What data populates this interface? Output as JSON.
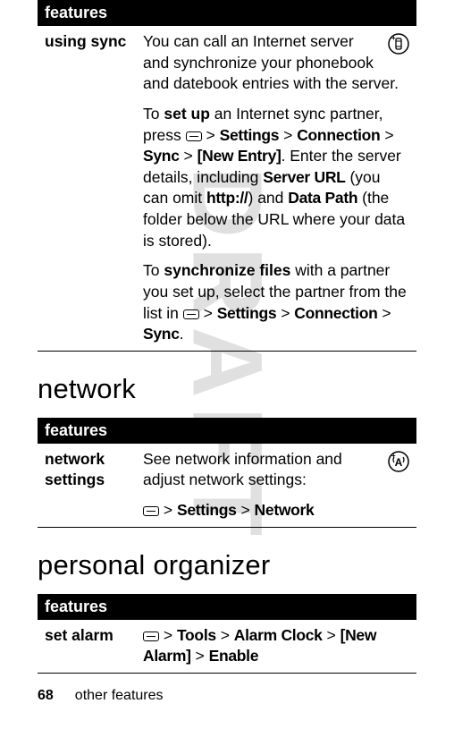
{
  "watermark": "DRAFT",
  "sections": {
    "top": {
      "header": "features",
      "row": {
        "label": "using sync",
        "para1_a": "You can call an Internet server and synchronize your phonebook and datebook entries with the server.",
        "para2_a": "To ",
        "para2_b": "set up",
        "para2_c": " an Internet sync partner, press ",
        "para2_path": {
          "settings": "Settings",
          "connection": "Connection",
          "sync": "Sync",
          "newentry": "[New Entry]"
        },
        "para2_d": ". Enter the server details, including ",
        "para2_serverurl": "Server URL",
        "para2_e": " (you can omit ",
        "para2_http": "http://",
        "para2_f": ") and ",
        "para2_datapath": "Data Path",
        "para2_g": " (the folder below the URL where your data is stored).",
        "para3_a": "To ",
        "para3_b": "synchronize files",
        "para3_c": " with a partner you set up, select the partner from the list in ",
        "para3_path": {
          "settings": "Settings",
          "connection": "Connection",
          "sync": "Sync"
        },
        "para3_d": "."
      }
    },
    "network": {
      "heading": "network",
      "header": "features",
      "row": {
        "label": "network settings",
        "desc": "See network information and adjust network settings:",
        "path": {
          "settings": "Settings",
          "network": "Network"
        }
      }
    },
    "organizer": {
      "heading": "personal organizer",
      "header": "features",
      "row": {
        "label": "set alarm",
        "path": {
          "tools": "Tools",
          "alarmclock": "Alarm Clock",
          "newalarm": "[New Alarm]",
          "enable": "Enable"
        }
      }
    }
  },
  "gt": " > ",
  "footer": {
    "page": "68",
    "section": "other features"
  },
  "chart_data": {
    "type": "table"
  }
}
